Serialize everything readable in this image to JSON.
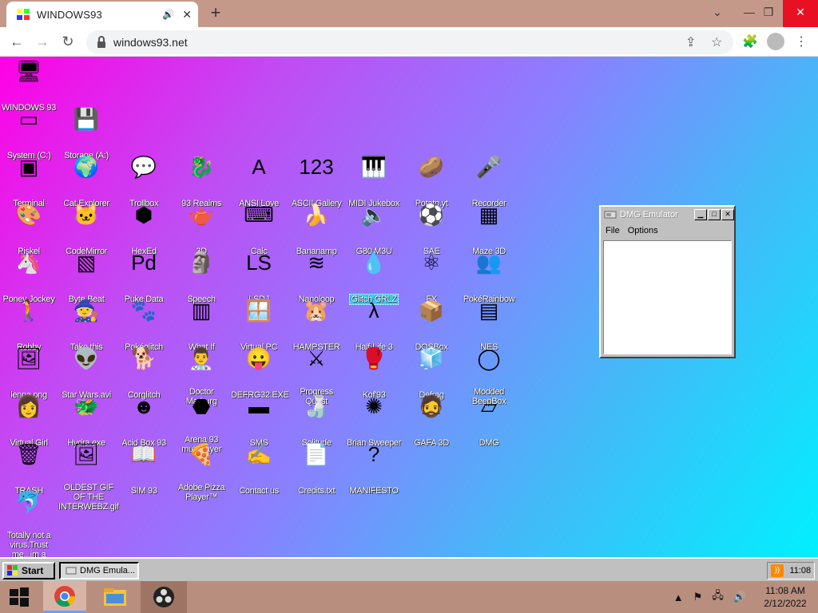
{
  "browser": {
    "tab_title": "WINDOWS93",
    "url": "windows93.net",
    "new_tab": "+",
    "tab_close": "✕",
    "minimize": "⌄",
    "restore": "❐",
    "maximize": "—",
    "close": "✕"
  },
  "desktop": {
    "icons": [
      {
        "label": "WINDOWS 93",
        "icon": "computer-icon",
        "glyph": "🖥"
      },
      {
        "label": "System (C:)",
        "icon": "hard-drive-icon",
        "glyph": "▭"
      },
      {
        "label": "Storage (A:)",
        "icon": "floppy-drive-icon",
        "glyph": "💾"
      },
      {
        "label": "Terminal",
        "icon": "terminal-icon",
        "glyph": "▣"
      },
      {
        "label": "Cat Explorer",
        "icon": "globe-cat-icon",
        "glyph": "🌍"
      },
      {
        "label": "Trollbox",
        "icon": "chat-bubble-icon",
        "glyph": "💬"
      },
      {
        "label": "93 Realms",
        "icon": "dragon-icon",
        "glyph": "🐉"
      },
      {
        "label": "ANSI Love",
        "icon": "letter-a-icon",
        "glyph": "A"
      },
      {
        "label": "ASCII Gallery",
        "icon": "numbers-icon",
        "glyph": "123"
      },
      {
        "label": "MIDI Jukebox",
        "icon": "piano-icon",
        "glyph": "🎹"
      },
      {
        "label": "Potato.yt",
        "icon": "potato-icon",
        "glyph": "🥔"
      },
      {
        "label": "Recorder",
        "icon": "microphone-icon",
        "glyph": "🎤"
      },
      {
        "label": "Piskel",
        "icon": "paint-palette-icon",
        "glyph": "🎨"
      },
      {
        "label": "CodeMirror",
        "icon": "code-cat-icon",
        "glyph": "🐱"
      },
      {
        "label": "HexEd",
        "icon": "cube-icon",
        "glyph": "⬢"
      },
      {
        "label": "3D",
        "icon": "teapot-icon",
        "glyph": "🫖"
      },
      {
        "label": "Calc",
        "icon": "calculator-icon",
        "glyph": "⌨"
      },
      {
        "label": "Bananamp",
        "icon": "banana-icon",
        "glyph": "🍌"
      },
      {
        "label": "G80.M3U",
        "icon": "audio-file-icon",
        "glyph": "🔈"
      },
      {
        "label": "SAE",
        "icon": "checkered-ball-icon",
        "glyph": "⚽"
      },
      {
        "label": "Maze 3D",
        "icon": "maze-icon",
        "glyph": "▦"
      },
      {
        "label": "Poney Jockey",
        "icon": "pony-icon",
        "glyph": "🦄"
      },
      {
        "label": "Byte Beat",
        "icon": "green-wave-icon",
        "glyph": "▧"
      },
      {
        "label": "Puke Data",
        "icon": "puke-data-icon",
        "glyph": "Pd"
      },
      {
        "label": "Speech",
        "icon": "face-icon",
        "glyph": "🗿"
      },
      {
        "label": "LSDJ",
        "icon": "lsdj-icon",
        "glyph": "LS"
      },
      {
        "label": "Nanoloop",
        "icon": "wave-lines-icon",
        "glyph": "≋"
      },
      {
        "label": "Glitch GRLZ",
        "icon": "glitch-icon",
        "glyph": "💧",
        "selected": true
      },
      {
        "label": "FX",
        "icon": "atom-icon",
        "glyph": "⚛"
      },
      {
        "label": "PokéRainbow",
        "icon": "pokemon-group-icon",
        "glyph": "👥"
      },
      {
        "label": "Robby",
        "icon": "stick-figure-icon",
        "glyph": "🚶"
      },
      {
        "label": "Take this",
        "icon": "monk-icon",
        "glyph": "🧙"
      },
      {
        "label": "Pokéglitch",
        "icon": "pokeglitch-icon",
        "glyph": "🐾"
      },
      {
        "label": "What If",
        "icon": "green-screen-icon",
        "glyph": "▥"
      },
      {
        "label": "Virtual PC",
        "icon": "window-cursor-icon",
        "glyph": "🪟"
      },
      {
        "label": "HAMPSTER",
        "icon": "hamster-icon",
        "glyph": "🐹"
      },
      {
        "label": "Half-Life 3",
        "icon": "lambda-icon",
        "glyph": "λ"
      },
      {
        "label": "DOSBox",
        "icon": "dosbox-icon",
        "glyph": "📦"
      },
      {
        "label": "NES",
        "icon": "nes-console-icon",
        "glyph": "▤"
      },
      {
        "label": "lenna.png",
        "icon": "image-file-icon",
        "glyph": "🖼"
      },
      {
        "label": "Star Wars.avi",
        "icon": "yoda-icon",
        "glyph": "👽"
      },
      {
        "label": "Corglitch",
        "icon": "corgi-icon",
        "glyph": "🐕"
      },
      {
        "label": "Doctor Marburg",
        "icon": "doctor-icon",
        "glyph": "👨‍⚕️"
      },
      {
        "label": "DEFRG32.EXE",
        "icon": "monitor-face-icon",
        "glyph": "😛"
      },
      {
        "label": "Progress Quest",
        "icon": "crossed-swords-icon",
        "glyph": "⚔"
      },
      {
        "label": "Kof'93",
        "icon": "fighter-icon",
        "glyph": "🥊"
      },
      {
        "label": "Defrag",
        "icon": "defrag-icon",
        "glyph": "🧊"
      },
      {
        "label": "Modded BeepBox",
        "icon": "green-ring-icon",
        "glyph": "◯"
      },
      {
        "label": "Virtual Girl",
        "icon": "girl-face-icon",
        "glyph": "👩"
      },
      {
        "label": "Hydra.exe",
        "icon": "hydra-icon",
        "glyph": "🐲"
      },
      {
        "label": "Acid Box 93",
        "icon": "smiley-icon",
        "glyph": "☻"
      },
      {
        "label": "Arena 93 multiplayer",
        "icon": "colored-cube-icon",
        "glyph": "⬣"
      },
      {
        "label": "SMS",
        "icon": "console-icon",
        "glyph": "▬"
      },
      {
        "label": "Solitude",
        "icon": "bottle-icon",
        "glyph": "🍶"
      },
      {
        "label": "Brian Sweeper",
        "icon": "mine-icon",
        "glyph": "✺"
      },
      {
        "label": "GAFA 3D",
        "icon": "soldier-face-icon",
        "glyph": "🧔"
      },
      {
        "label": "DMG",
        "icon": "gameboy-icon",
        "glyph": "▱"
      },
      {
        "label": "TRASH",
        "icon": "trash-icon",
        "glyph": "🗑"
      },
      {
        "label": "OLDEST GIF OF THE INTERWEBZ.gif",
        "icon": "gif-file-icon",
        "glyph": "🖼"
      },
      {
        "label": "SIM 93",
        "icon": "book-icon",
        "glyph": "📖"
      },
      {
        "label": "Adobe Pizza Player™",
        "icon": "pizza-icon",
        "glyph": "🍕"
      },
      {
        "label": "Contact us",
        "icon": "contact-icon",
        "glyph": "✍"
      },
      {
        "label": "Credits.txt",
        "icon": "text-file-icon",
        "glyph": "📄"
      },
      {
        "label": "MANIFESTO",
        "icon": "question-mark-icon",
        "glyph": "?"
      },
      {
        "label": "Totally not a virus.Trust me...im a dolphin",
        "icon": "dolphin-icon",
        "glyph": "🐬"
      }
    ]
  },
  "dmg_window": {
    "title": "DMG Emulator",
    "menu": [
      "File",
      "Options"
    ],
    "min": "▁",
    "max": "□",
    "close": "✕"
  },
  "w93_taskbar": {
    "start_label": "Start",
    "task_label": "DMG Emula...",
    "clock": "11:08",
    "rss": "))"
  },
  "windows_taskbar": {
    "time": "11:08 AM",
    "date": "2/12/2022",
    "tray_chevron": "▲"
  },
  "colors": {
    "gradient_start": "#ff00e6",
    "gradient_end": "#00f0ff",
    "selection": "#33ccff",
    "win_gray": "#c0c0c0"
  }
}
